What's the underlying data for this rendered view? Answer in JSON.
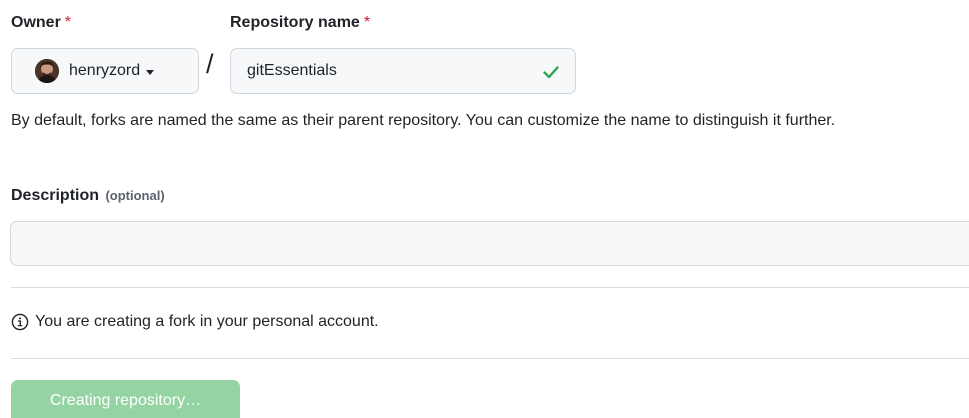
{
  "owner": {
    "label": "Owner",
    "required_mark": "*",
    "selected": "henryzord",
    "avatar_icon": "user-avatar"
  },
  "separator": "/",
  "repository": {
    "label": "Repository name",
    "required_mark": "*",
    "value": "gitEssentials",
    "status_icon": "check-icon",
    "status_color": "#2da44e"
  },
  "help_text": "By default, forks are named the same as their parent repository. You can customize the name to distinguish it further.",
  "description": {
    "label": "Description",
    "optional_label": "(optional)",
    "value": ""
  },
  "notice": {
    "icon": "info-icon",
    "text": "You are creating a fork in your personal account."
  },
  "submit": {
    "label": "Creating repository…",
    "state": "disabled",
    "color": "#94d3a2"
  },
  "colors": {
    "required": "#cf222e",
    "text": "#1f2328",
    "muted": "#59636e",
    "border": "#d0d7de"
  }
}
